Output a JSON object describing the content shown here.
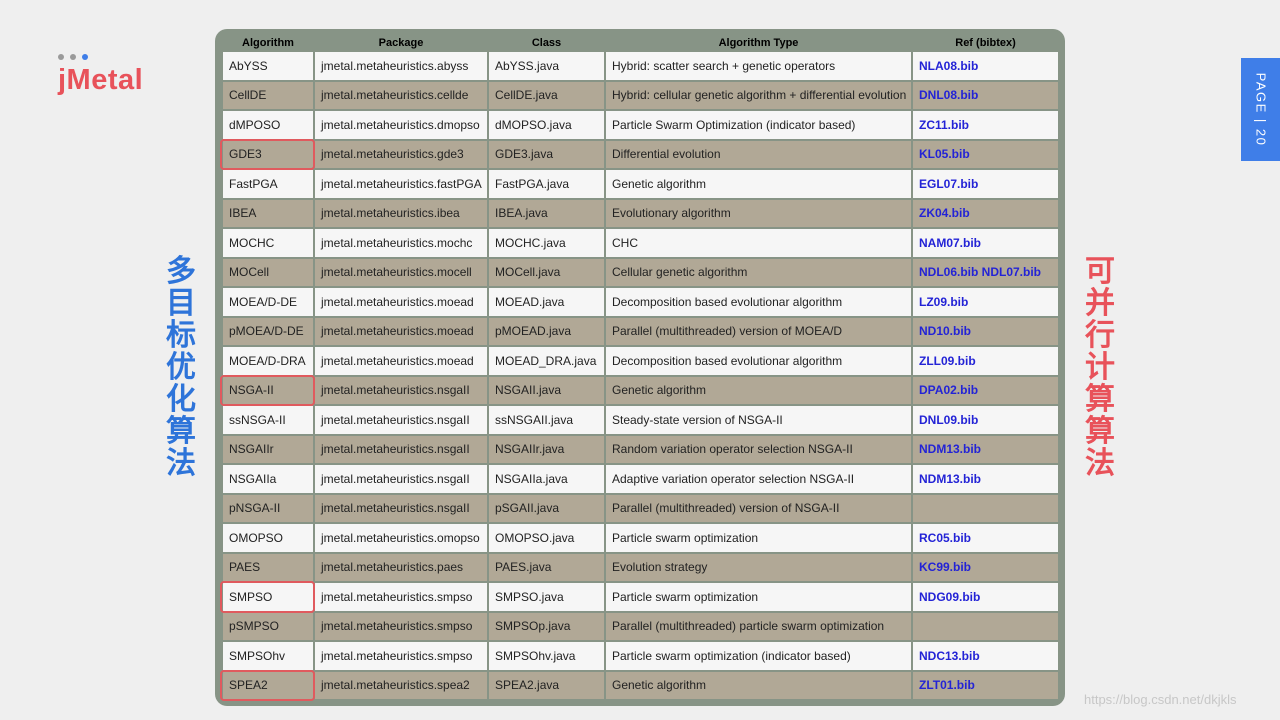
{
  "logo": {
    "text": "jMetal",
    "dots": [
      "#9a9a9a",
      "#9a9a9a",
      "#3f7ee8"
    ]
  },
  "left_vertical_text": [
    "多",
    "目",
    "标",
    "优",
    "化",
    "算",
    "法"
  ],
  "right_vertical_text": [
    "可",
    "并",
    "行",
    "计",
    "算",
    "算",
    "法"
  ],
  "page_tab": "PAGE | 20",
  "watermark": "https://blog.csdn.net/dkjkls",
  "colors": {
    "accent_blue": "#2e74d9",
    "accent_red": "#e8525a",
    "panel_bg": "#879486",
    "row_light": "#f6f6f6",
    "row_dark": "#b1a896",
    "ref_link": "#2323d6",
    "highlight_border": "#e05a5e",
    "page_tab_bg": "#3f7ee8",
    "watermark": "#c7c7c7"
  },
  "table": {
    "headers": [
      "Algorithm",
      "Package",
      "Class",
      "Algorithm Type",
      "Ref (bibtex)"
    ],
    "highlighted_algorithms": [
      "GDE3",
      "NSGA-II",
      "SMPSO",
      "SPEA2"
    ],
    "rows": [
      {
        "algorithm": "AbYSS",
        "package": "jmetal.metaheuristics.abyss",
        "class": "AbYSS.java",
        "type": "Hybrid: scatter search + genetic operators",
        "ref": "NLA08.bib"
      },
      {
        "algorithm": "CellDE",
        "package": "jmetal.metaheuristics.cellde",
        "class": "CellDE.java",
        "type": "Hybrid: cellular genetic algorithm + differential evolution",
        "ref": "DNL08.bib"
      },
      {
        "algorithm": "dMPOSO",
        "package": "jmetal.metaheuristics.dmopso",
        "class": "dMOPSO.java",
        "type": "Particle Swarm Optimization (indicator based)",
        "ref": "ZC11.bib"
      },
      {
        "algorithm": "GDE3",
        "package": "jmetal.metaheuristics.gde3",
        "class": "GDE3.java",
        "type": "Differential evolution",
        "ref": "KL05.bib"
      },
      {
        "algorithm": "FastPGA",
        "package": "jmetal.metaheuristics.fastPGA",
        "class": "FastPGA.java",
        "type": "Genetic algorithm",
        "ref": "EGL07.bib"
      },
      {
        "algorithm": "IBEA",
        "package": "jmetal.metaheuristics.ibea",
        "class": "IBEA.java",
        "type": "Evolutionary algorithm",
        "ref": "ZK04.bib"
      },
      {
        "algorithm": "MOCHC",
        "package": "jmetal.metaheuristics.mochc",
        "class": "MOCHC.java",
        "type": "CHC",
        "ref": "NAM07.bib"
      },
      {
        "algorithm": "MOCell",
        "package": "jmetal.metaheuristics.mocell",
        "class": "MOCell.java",
        "type": "Cellular genetic algorithm",
        "ref": "NDL06.bib NDL07.bib"
      },
      {
        "algorithm": "MOEA/D-DE",
        "package": "jmetal.metaheuristics.moead",
        "class": "MOEAD.java",
        "type": "Decomposition based evolutionar algorithm",
        "ref": "LZ09.bib"
      },
      {
        "algorithm": "pMOEA/D-DE",
        "package": "jmetal.metaheuristics.moead",
        "class": "pMOEAD.java",
        "type": "Parallel (multithreaded) version of MOEA/D",
        "ref": "ND10.bib"
      },
      {
        "algorithm": "MOEA/D-DRA",
        "package": "jmetal.metaheuristics.moead",
        "class": "MOEAD_DRA.java",
        "type": "Decomposition based evolutionar algorithm",
        "ref": "ZLL09.bib"
      },
      {
        "algorithm": "NSGA-II",
        "package": "jmetal.metaheuristics.nsgaII",
        "class": "NSGAII.java",
        "type": "Genetic algorithm",
        "ref": "DPA02.bib"
      },
      {
        "algorithm": "ssNSGA-II",
        "package": "jmetal.metaheuristics.nsgaII",
        "class": "ssNSGAII.java",
        "type": "Steady-state version of NSGA-II",
        "ref": "DNL09.bib"
      },
      {
        "algorithm": "NSGAIIr",
        "package": "jmetal.metaheuristics.nsgaII",
        "class": "NSGAIIr.java",
        "type": "Random variation operator selection NSGA-II",
        "ref": "NDM13.bib"
      },
      {
        "algorithm": "NSGAIIa",
        "package": "jmetal.metaheuristics.nsgaII",
        "class": "NSGAIIa.java",
        "type": "Adaptive variation operator selection NSGA-II",
        "ref": "NDM13.bib"
      },
      {
        "algorithm": "pNSGA-II",
        "package": "jmetal.metaheuristics.nsgaII",
        "class": "pSGAII.java",
        "type": "Parallel (multithreaded) version of NSGA-II",
        "ref": ""
      },
      {
        "algorithm": "OMOPSO",
        "package": "jmetal.metaheuristics.omopso",
        "class": "OMOPSO.java",
        "type": "Particle swarm optimization",
        "ref": "RC05.bib"
      },
      {
        "algorithm": "PAES",
        "package": "jmetal.metaheuristics.paes",
        "class": "PAES.java",
        "type": "Evolution strategy",
        "ref": "KC99.bib"
      },
      {
        "algorithm": "SMPSO",
        "package": "jmetal.metaheuristics.smpso",
        "class": "SMPSO.java",
        "type": "Particle swarm optimization",
        "ref": "NDG09.bib"
      },
      {
        "algorithm": "pSMPSO",
        "package": "jmetal.metaheuristics.smpso",
        "class": "SMPSOp.java",
        "type": "Parallel (multithreaded) particle swarm optimization",
        "ref": ""
      },
      {
        "algorithm": "SMPSOhv",
        "package": "jmetal.metaheuristics.smpso",
        "class": "SMPSOhv.java",
        "type": "Particle swarm optimization (indicator based)",
        "ref": "NDC13.bib"
      },
      {
        "algorithm": "SPEA2",
        "package": "jmetal.metaheuristics.spea2",
        "class": "SPEA2.java",
        "type": "Genetic algorithm",
        "ref": "ZLT01.bib"
      }
    ]
  }
}
